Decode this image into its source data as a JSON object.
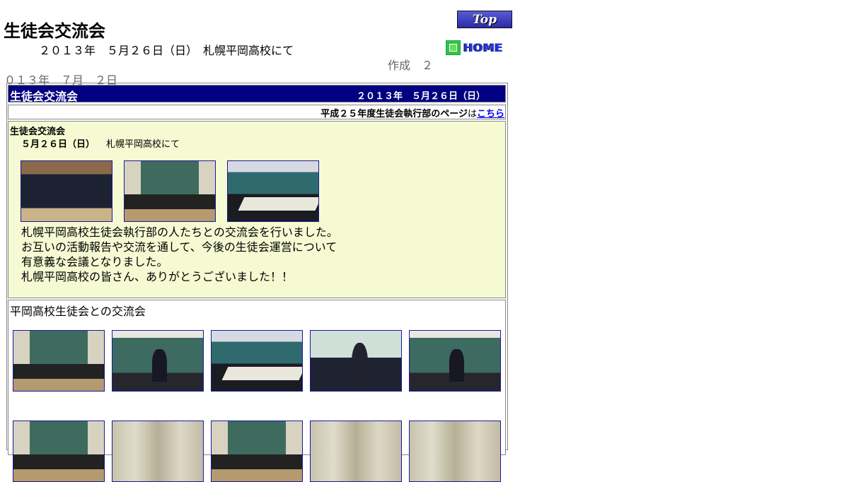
{
  "header": {
    "title": "生徒会交流会",
    "subtitle": "２０１３年　５月２６日（日）　札幌平岡高校にて",
    "created_line1": "作成　２",
    "created_line2": "０１３年　７月　２日",
    "top_button_label": "Top",
    "home_button_label": "HOME"
  },
  "bar": {
    "title": "生徒会交流会",
    "date": "２０１３年　５月２６日（日）"
  },
  "link_row": {
    "text": "平成２５年度生徒会執行部のページ",
    "particle": "は",
    "link": "こちら"
  },
  "section1": {
    "title": "生徒会交流会",
    "date": "５月２６日（日）",
    "place": "札幌平岡高校にて",
    "body": [
      "札幌平岡高校生徒会執行部の人たちとの交流会を行いました。",
      "お互いの活動報告や交流を通して、今後の生徒会運営について",
      "有意義な会議となりました。",
      "札幌平岡高校の皆さん、ありがとうございました！！"
    ]
  },
  "section2": {
    "title": "平岡高校生徒会との交流会"
  },
  "colors": {
    "bar_bg": "#000080",
    "section_bg": "#f5fad2",
    "link": "#0000ee",
    "photo_border": "#1a1a99"
  }
}
